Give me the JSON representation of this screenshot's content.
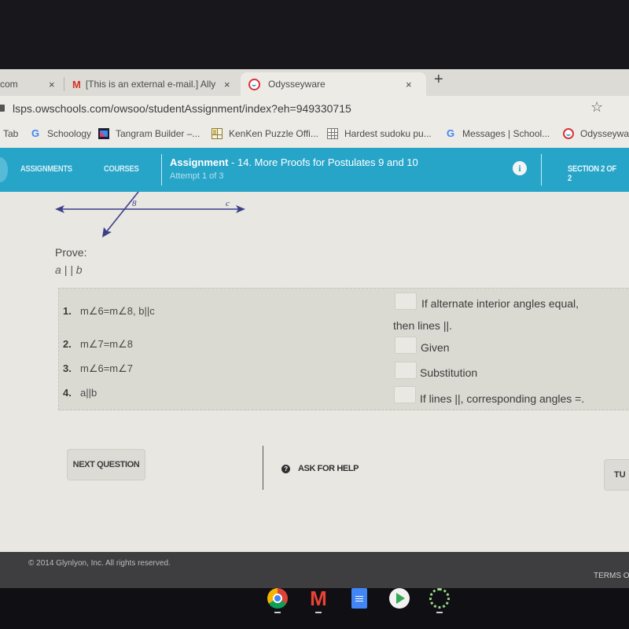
{
  "browser": {
    "tabs": [
      {
        "label": "com",
        "close": "×",
        "active": false
      },
      {
        "label": "[This is an external e-mail.] Allyso",
        "icon": "gmail-icon",
        "close": "×",
        "active": false
      },
      {
        "label": "Odysseyware",
        "icon": "odysseyware-icon",
        "close": "×",
        "active": true
      }
    ],
    "new_tab": "+",
    "url": "lsps.owschools.com/owsoo/studentAssignment/index?eh=949330715",
    "star": "☆",
    "bookmarks": [
      {
        "label": "Tab",
        "icon": ""
      },
      {
        "label": "Schoology",
        "icon": "google-icon"
      },
      {
        "label": "Tangram Builder –...",
        "icon": "tangram-icon"
      },
      {
        "label": "KenKen Puzzle Offi...",
        "icon": "kenken-icon"
      },
      {
        "label": "Hardest sudoku pu...",
        "icon": "sudoku-icon"
      },
      {
        "label": "Messages | School...",
        "icon": "google-icon"
      },
      {
        "label": "Odysseywa",
        "icon": "odysseyware-icon"
      }
    ]
  },
  "nav": {
    "assignments": "ASSIGNMENTS",
    "courses": "COURSES",
    "assignment_label": "Assignment",
    "assignment_title": " - 14. More Proofs for Postulates 9 and 10",
    "attempt": "Attempt 1 of 3",
    "info_icon": "i",
    "section": "SECTION 2 OF 2",
    "accent_color": "#27a5c9"
  },
  "figure": {
    "angle_label": "8",
    "line_label": "c"
  },
  "prove": {
    "label": "Prove:",
    "statement": "a | | b"
  },
  "proof": {
    "statements": [
      {
        "num": "1.",
        "text": "m∠6=m∠8, b||c"
      },
      {
        "num": "2.",
        "text": "m∠7=m∠8"
      },
      {
        "num": "3.",
        "text": "m∠6=m∠7"
      },
      {
        "num": "4.",
        "text": "a||b"
      }
    ],
    "reasons": [
      {
        "text": "If alternate interior angles equal,",
        "continuation": "then lines ||."
      },
      {
        "text": "Given"
      },
      {
        "text": "Substitution"
      },
      {
        "text": "If lines ||, corresponding angles =."
      }
    ]
  },
  "actions": {
    "next_question": "NEXT QUESTION",
    "help_icon": "?",
    "ask_for_help": "ASK FOR HELP",
    "turn_in": "TU"
  },
  "footer": {
    "copyright": "© 2014 Glynlyon, Inc. All rights reserved.",
    "terms": "TERMS O"
  },
  "shelf": {
    "apps": [
      "chrome-icon",
      "gmail-icon",
      "docs-icon",
      "play-store-icon",
      "launcher-icon"
    ]
  }
}
